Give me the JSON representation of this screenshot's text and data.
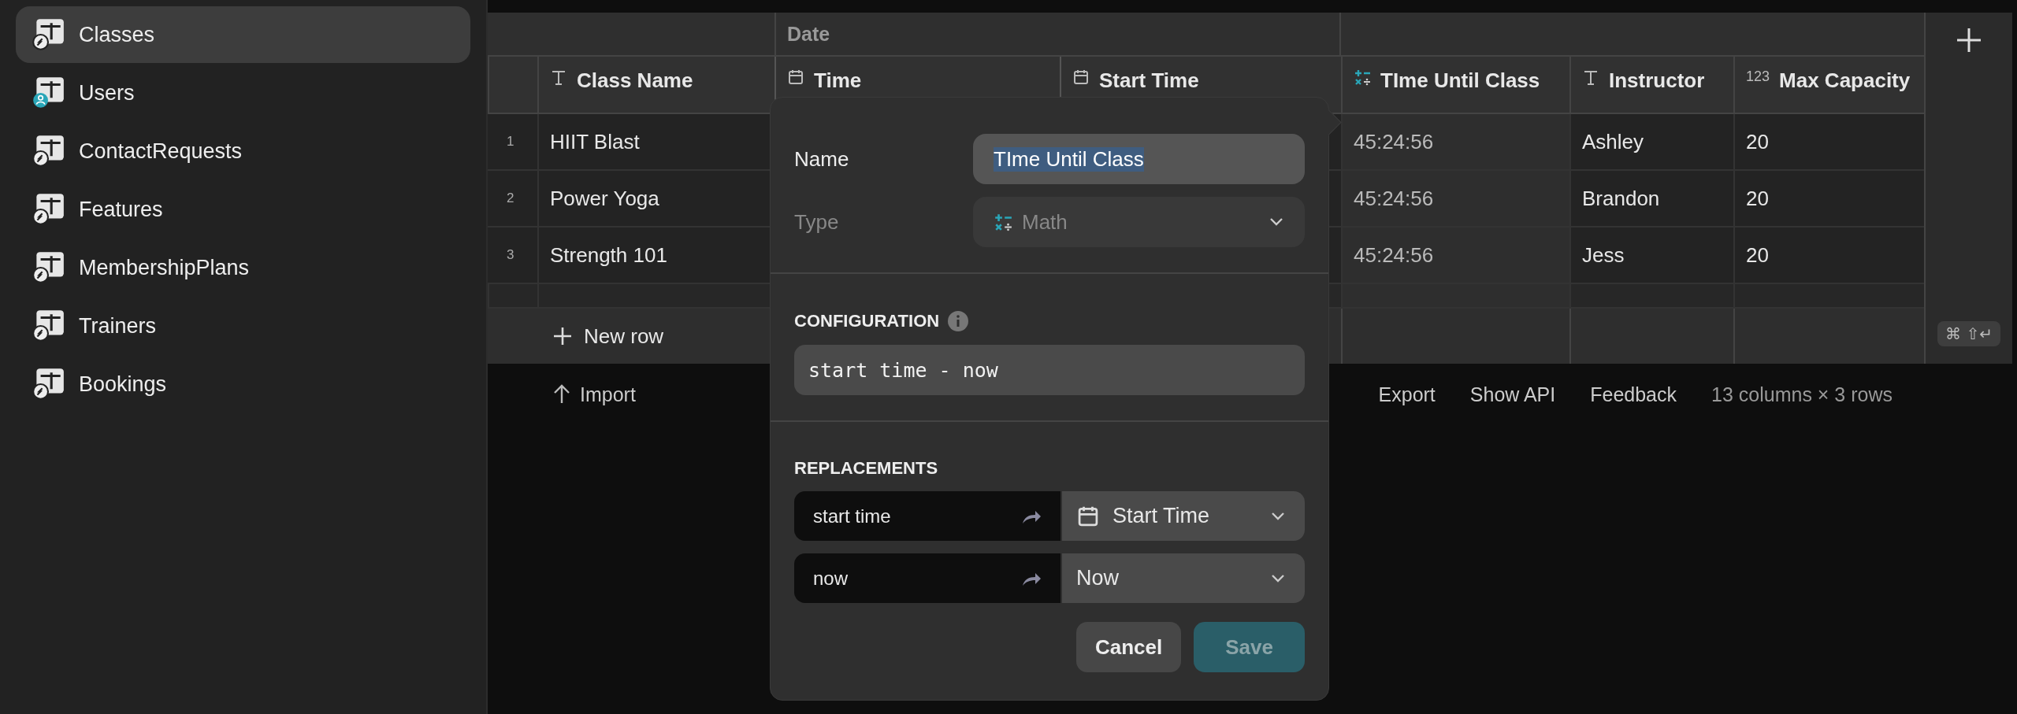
{
  "sidebar": {
    "items": [
      {
        "label": "Classes",
        "kind": "bolt",
        "selected": true
      },
      {
        "label": "Users",
        "kind": "user",
        "selected": false
      },
      {
        "label": "ContactRequests",
        "kind": "bolt",
        "selected": false
      },
      {
        "label": "Features",
        "kind": "bolt",
        "selected": false
      },
      {
        "label": "MembershipPlans",
        "kind": "bolt",
        "selected": false
      },
      {
        "label": "Trainers",
        "kind": "bolt",
        "selected": false
      },
      {
        "label": "Bookings",
        "kind": "bolt",
        "selected": false
      }
    ]
  },
  "table": {
    "group_header": {
      "label": "Date"
    },
    "columns": [
      {
        "label": "Class Name",
        "kind": "text",
        "in_group": false
      },
      {
        "label": "Time",
        "kind": "date",
        "in_group": true
      },
      {
        "label": "Start Time",
        "kind": "date",
        "in_group": true
      },
      {
        "label": "TIme Until Class",
        "kind": "math",
        "in_group": false
      },
      {
        "label": "Instructor",
        "kind": "text",
        "in_group": false
      },
      {
        "label": "Max Capacity",
        "kind": "number",
        "type_label": "123",
        "in_group": false
      }
    ],
    "rows": [
      {
        "number": "1",
        "cells": [
          "HIIT Blast",
          null,
          null,
          "45:24:56",
          "Ashley",
          "20"
        ]
      },
      {
        "number": "2",
        "cells": [
          "Power Yoga",
          null,
          null,
          "45:24:56",
          "Brandon",
          "20"
        ]
      },
      {
        "number": "3",
        "cells": [
          "Strength 101",
          null,
          null,
          "45:24:56",
          "Jess",
          "20"
        ]
      }
    ],
    "new_row": "New row",
    "shortcut": "⌘ ⇧↵"
  },
  "footer": {
    "import": "Import",
    "links": [
      "Export",
      "Show API",
      "Feedback"
    ],
    "summary": "13 columns × 3 rows"
  },
  "popover": {
    "name_label": "Name",
    "name_value": "TIme Until Class",
    "name_selected": true,
    "type_label": "Type",
    "type_value": "Math",
    "type_disabled": true,
    "configuration_heading": "CONFIGURATION",
    "formula": "start time - now",
    "replacements_heading": "REPLACEMENTS",
    "replacements": [
      {
        "token": "start time",
        "target": "Start Time",
        "kind": "date"
      },
      {
        "token": "now",
        "target": "Now",
        "kind": "value"
      }
    ],
    "buttons": [
      {
        "label": "Cancel",
        "kind": "secondary",
        "disabled": false
      },
      {
        "label": "Save",
        "kind": "primary",
        "disabled": true
      }
    ]
  }
}
